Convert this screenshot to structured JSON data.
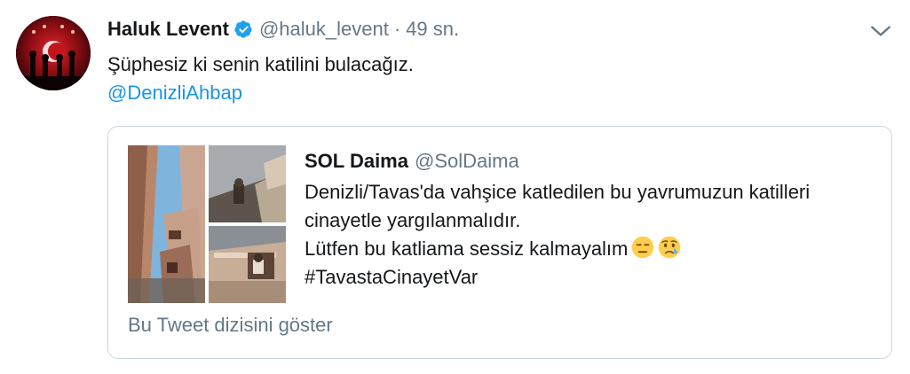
{
  "tweet": {
    "author_name": "Haluk Levent",
    "author_handle": "@haluk_levent",
    "separator": "·",
    "time": "49 sn.",
    "text": "Şüphesiz ki senin katilini bulacağız.",
    "mention": "@DenizliAhbap",
    "verified": true,
    "icons": {
      "verified": "verified-badge-icon",
      "menu": "chevron-down-icon"
    }
  },
  "quoted_tweet": {
    "author_name": "SOL Daima",
    "author_handle": "@SolDaima",
    "lines": [
      "Denizli/Tavas'da vahşice katledilen bu yavrumuzun katilleri",
      "cinayetle yargılanmalıdır.",
      "Lütfen bu katliama sessiz kalmayalım"
    ],
    "emojis": [
      "expressionless-face-icon",
      "sad-but-relieved-face-icon"
    ],
    "hashtag": "#TavastaCinayetVar",
    "show_thread": "Bu Tweet dizisini göster",
    "media_count": 3
  },
  "colors": {
    "text": "#14171a",
    "secondary": "#657786",
    "link": "#1b95e0",
    "border": "#ccd6dd",
    "verified": "#1da1f2"
  }
}
